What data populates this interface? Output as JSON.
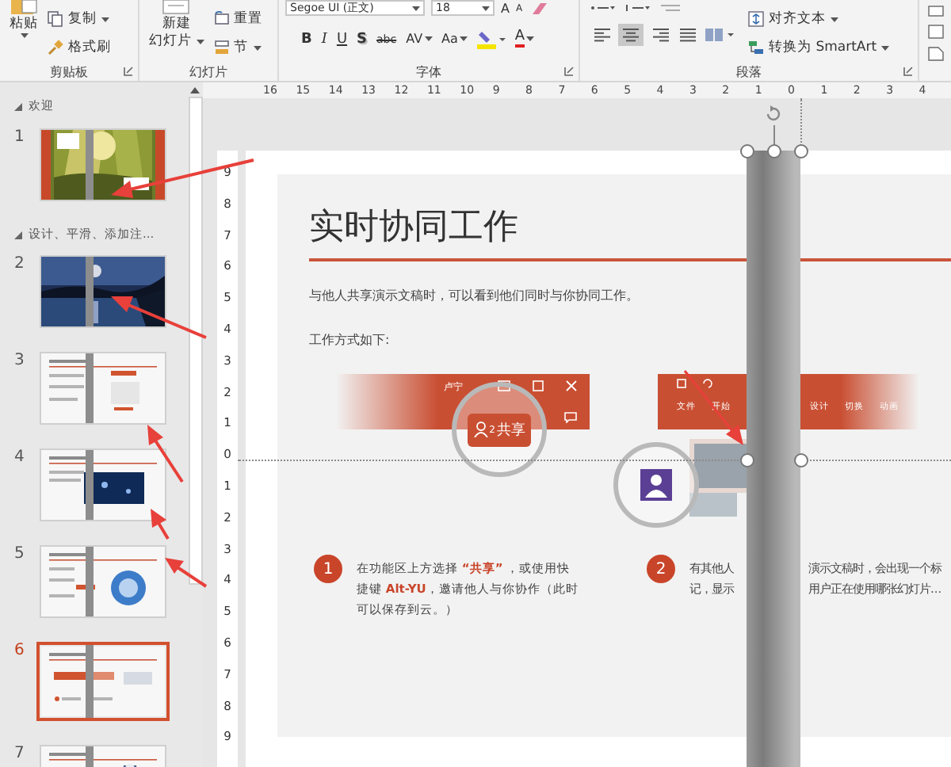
{
  "ribbon": {
    "clipboard": {
      "label": "剪贴板",
      "paste": "粘贴",
      "copy": "复制",
      "format_painter": "格式刷"
    },
    "slides": {
      "label": "幻灯片",
      "new_slide": "新建",
      "new_slide_line2": "幻灯片",
      "reset": "重置",
      "section": "节"
    },
    "font": {
      "label": "字体",
      "name": "Segoe UI (正文)",
      "size": "18",
      "grow": "A",
      "shrink": "A",
      "font_color": "A",
      "styles": [
        {
          "kind": "bold",
          "label": "B",
          "has_menu": false
        },
        {
          "kind": "italic",
          "label": "I",
          "has_menu": false
        },
        {
          "kind": "underline",
          "label": "U",
          "has_menu": false
        },
        {
          "kind": "shadow",
          "label": "S",
          "has_menu": false
        },
        {
          "kind": "strike",
          "label": "abc",
          "has_menu": false
        },
        {
          "kind": "spacing",
          "label": "AV",
          "has_menu": true
        },
        {
          "kind": "case",
          "label": "Aa",
          "has_menu": true
        }
      ]
    },
    "paragraph": {
      "label": "段落",
      "align_text": "对齐文本",
      "smartart": "转换为 SmartArt",
      "align": [
        {
          "kind": "left",
          "selected": false
        },
        {
          "kind": "center",
          "selected": true
        },
        {
          "kind": "right",
          "selected": false
        },
        {
          "kind": "justify",
          "selected": false
        }
      ]
    }
  },
  "rulers": {
    "horizontal": [
      "16",
      "15",
      "14",
      "13",
      "12",
      "11",
      "10",
      "9",
      "8",
      "7",
      "6",
      "5",
      "4",
      "3",
      "2",
      "1",
      "0",
      "1",
      "2",
      "3",
      "4"
    ],
    "vertical": [
      "9",
      "8",
      "7",
      "6",
      "5",
      "4",
      "3",
      "2",
      "1",
      "0",
      "1",
      "2",
      "3",
      "4",
      "5",
      "6",
      "7",
      "8",
      "9"
    ]
  },
  "slide_pane": {
    "sections": [
      {
        "title": "欢迎",
        "slides": [
          {
            "number": "1",
            "selected": false,
            "kind": "forest"
          }
        ]
      },
      {
        "title": "设计、平滑、添加注...",
        "slides": [
          {
            "number": "2",
            "selected": false,
            "kind": "night"
          },
          {
            "number": "3",
            "selected": false,
            "kind": "text_image"
          },
          {
            "number": "4",
            "selected": false,
            "kind": "text_photo"
          },
          {
            "number": "5",
            "selected": false,
            "kind": "text_chart"
          },
          {
            "number": "6",
            "selected": true,
            "kind": "text_banner"
          },
          {
            "number": "7",
            "selected": false,
            "kind": "text_figure"
          }
        ]
      }
    ]
  },
  "slide": {
    "title": "实时协同工作",
    "intro": "与他人共享演示文稿时，可以看到他们同时与你协同工作。",
    "subhead": "工作方式如下:",
    "left_screenshot": {
      "user": "卢宁",
      "share_count": "2",
      "share_label": "共享"
    },
    "right_screenshot": {
      "tabs": [
        "文件",
        "开始",
        "设计",
        "切换",
        "动画"
      ]
    },
    "steps": [
      {
        "number": "1",
        "text": "在功能区上方选择 **“共享”** ，或使用快捷键 **Alt-YU**，邀请他人与你协作（此时可以保存到云。）"
      },
      {
        "number": "2",
        "lines": [
          [
            "有其他人",
            "演示文稿时，会出现一个标"
          ],
          [
            "记，显示",
            "用户正在使用哪张幻灯片..."
          ]
        ]
      }
    ]
  }
}
